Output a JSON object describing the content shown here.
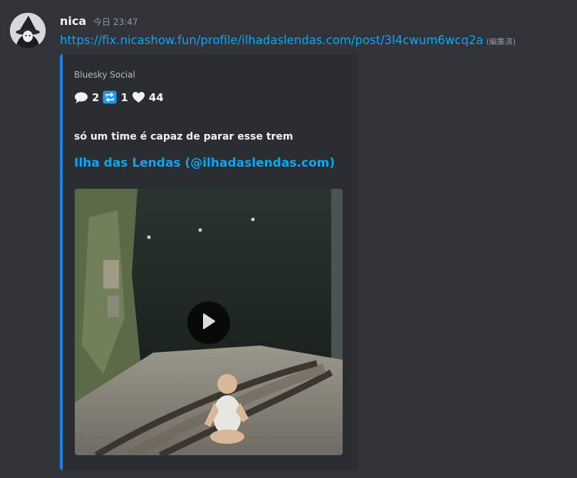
{
  "message": {
    "username": "nica",
    "timestamp": "今日 23:47",
    "link": "https://fix.nicashow.fun/profile/ilhadaslendas.com/post/3l4cwum6wcq2a",
    "edited_label": "(編集済)"
  },
  "embed": {
    "accent_color": "#0a84ff",
    "provider": "Bluesky Social",
    "stats": [
      {
        "icon": "speech-bubble-icon",
        "value": "2"
      },
      {
        "icon": "repost-icon",
        "value": "1"
      },
      {
        "icon": "heart-icon",
        "value": "44"
      }
    ],
    "description": "só um time é capaz de parar esse trem",
    "author": "Ilha das Lendas (@ilhadaslendas.com)",
    "video": {
      "play_icon": "play-icon"
    }
  },
  "colors": {
    "background": "#313338",
    "embed_background": "#2b2d31",
    "link": "#00a8fc"
  }
}
